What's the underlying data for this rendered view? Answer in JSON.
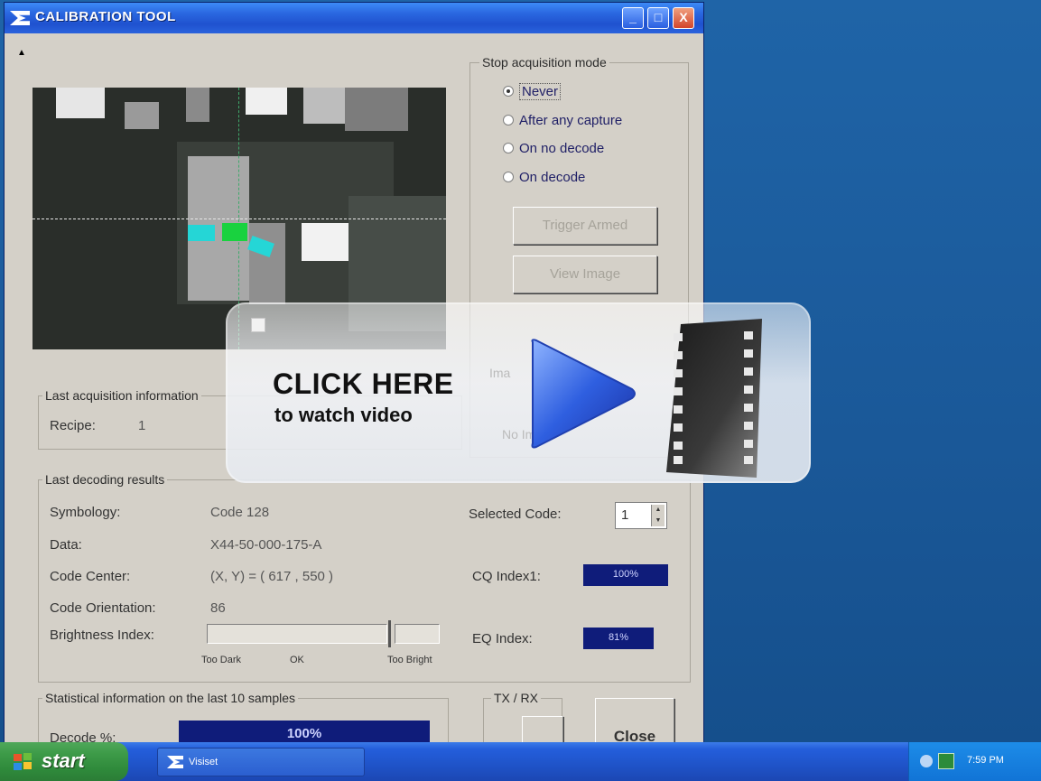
{
  "window": {
    "title": "CALIBRATION TOOL",
    "controls": {
      "minimize": "_",
      "maximize": "□",
      "close": "X"
    }
  },
  "stop_mode": {
    "legend": "Stop acquisition mode",
    "options": [
      "Never",
      "After any capture",
      "On no decode",
      "On decode"
    ],
    "selected": "Never",
    "trigger_label": "Trigger Armed",
    "view_label": "View Image"
  },
  "last_acquisition": {
    "legend": "Last acquisition information",
    "recipe_label": "Recipe:",
    "recipe_value": "1"
  },
  "last_decoding": {
    "legend": "Last decoding results",
    "symbology_label": "Symbology:",
    "symbology_value": "Code 128",
    "data_label": "Data:",
    "data_value": "X44-50-000-175-A",
    "center_label": "Code Center:",
    "center_value": "(X, Y) = ( 617 , 550 )",
    "orientation_label": "Code Orientation:",
    "orientation_value": "86",
    "brightness_label": "Brightness Index:",
    "too_dark": "Too Dark",
    "ok": "OK",
    "too_bright": "Too Bright",
    "selected_code_label": "Selected Code:",
    "selected_code_value": "1",
    "cq_label": "CQ Index1:",
    "cq_value": "100%",
    "eq_label": "EQ Index:",
    "eq_value": "81%"
  },
  "statistics": {
    "legend": "Statistical information on the last 10 samples",
    "decode_label": "Decode %:",
    "decode_value": "100%"
  },
  "txrx": {
    "legend": "TX / RX"
  },
  "close_button": "Close",
  "overlay": {
    "line1": "CLICK HERE",
    "line2": "to watch video",
    "hidden_text_1": "Ima",
    "hidden_text_2": "No Image"
  },
  "taskbar": {
    "start_label": "start",
    "task_label": "Visiset",
    "clock": "7:59 PM"
  },
  "colors": {
    "titlebar": "#2a67e0",
    "panel": "#d4d0c8",
    "index_box": "#0f1c7a",
    "desktop": "#1c5a9c",
    "taskbar": "#245edb",
    "start": "#3d9b48"
  }
}
